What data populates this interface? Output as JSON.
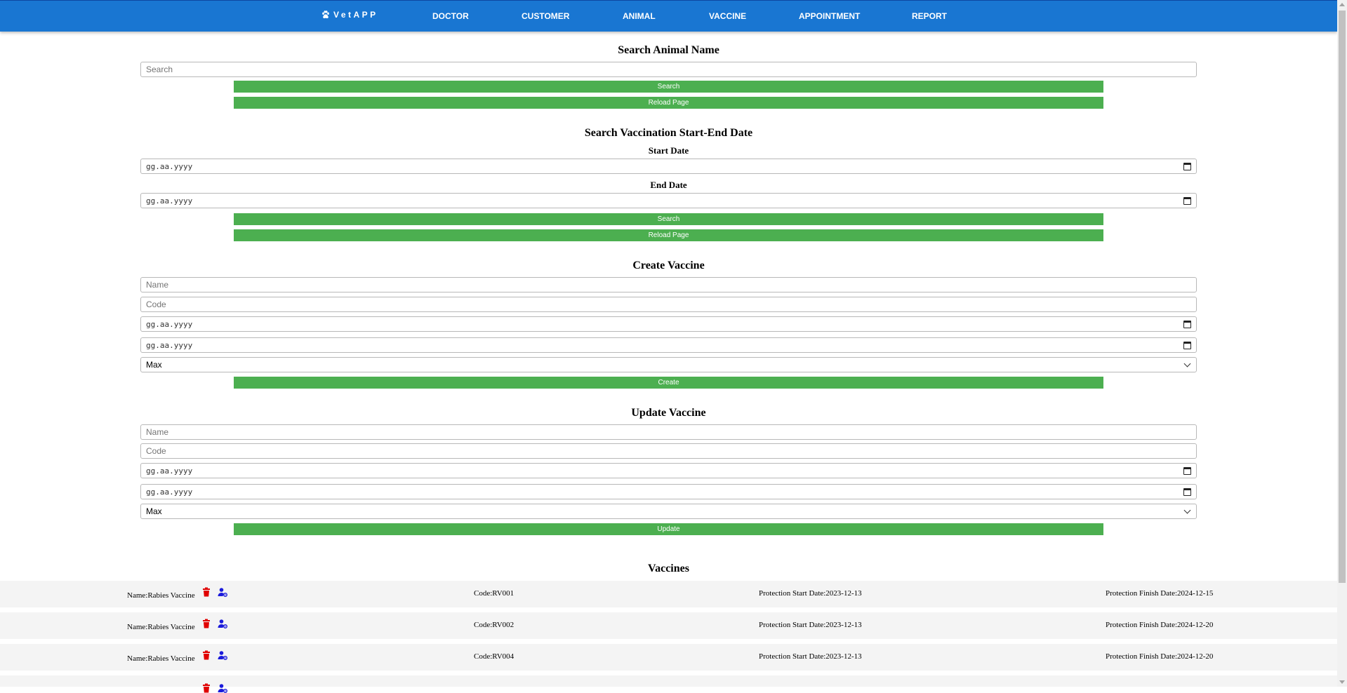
{
  "nav": {
    "brand": "VetAPP",
    "items": [
      "DOCTOR",
      "CUSTOMER",
      "ANIMAL",
      "VACCINE",
      "APPOINTMENT",
      "REPORT"
    ]
  },
  "search_animal": {
    "title": "Search Animal Name",
    "placeholder": "Search",
    "search_label": "Search",
    "reload_label": "Reload Page"
  },
  "search_date": {
    "title": "Search Vaccination Start-End Date",
    "start_label": "Start Date",
    "end_label": "End Date",
    "date_placeholder": "gg.aa.yyyy",
    "search_label": "Search",
    "reload_label": "Reload Page"
  },
  "create": {
    "title": "Create Vaccine",
    "name_placeholder": "Name",
    "code_placeholder": "Code",
    "date_placeholder": "gg.aa.yyyy",
    "select_value": "Max",
    "button_label": "Create"
  },
  "update": {
    "title": "Update Vaccine",
    "name_placeholder": "Name",
    "code_placeholder": "Code",
    "date_placeholder": "gg.aa.yyyy",
    "select_value": "Max",
    "button_label": "Update"
  },
  "vaccines": {
    "title": "Vaccines",
    "rows": [
      {
        "name": "Name:Rabies Vaccine",
        "code": "Code:RV001",
        "start": "Protection Start Date:2023-12-13",
        "finish": "Protection Finish Date:2024-12-15"
      },
      {
        "name": "Name:Rabies Vaccine",
        "code": "Code:RV002",
        "start": "Protection Start Date:2023-12-13",
        "finish": "Protection Finish Date:2024-12-20"
      },
      {
        "name": "Name:Rabies Vaccine",
        "code": "Code:RV004",
        "start": "Protection Start Date:2023-12-13",
        "finish": "Protection Finish Date:2024-12-20"
      }
    ]
  },
  "colors": {
    "navbar": "#1976d2",
    "button": "#4caf50",
    "delete_icon": "#e00000",
    "edit_icon": "#1a1adb"
  }
}
